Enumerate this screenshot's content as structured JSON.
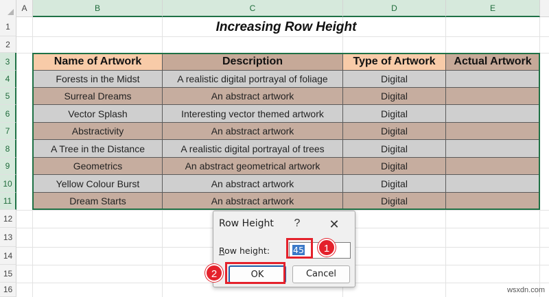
{
  "columns": [
    "A",
    "B",
    "C",
    "D",
    "E"
  ],
  "rows": [
    "1",
    "2",
    "3",
    "4",
    "5",
    "6",
    "7",
    "8",
    "9",
    "10",
    "11",
    "12",
    "13",
    "14",
    "15",
    "16"
  ],
  "sheet_title": "Increasing Row Height",
  "table": {
    "headers": [
      "Name of Artwork",
      "Description",
      "Type of Artwork",
      "Actual Artwork"
    ],
    "rows": [
      [
        "Forests in the Midst",
        "A realistic digital portrayal of  foliage",
        "Digital",
        ""
      ],
      [
        "Surreal Dreams",
        "An abstract artwork",
        "Digital",
        ""
      ],
      [
        "Vector Splash",
        "Interesting vector themed artwork",
        "Digital",
        ""
      ],
      [
        "Abstractivity",
        "An abstract artwork",
        "Digital",
        ""
      ],
      [
        "A Tree in the Distance",
        "A realistic digital portrayal of trees",
        "Digital",
        ""
      ],
      [
        "Geometrics",
        "An abstract geometrical artwork",
        "Digital",
        ""
      ],
      [
        "Yellow Colour Burst",
        "An abstract artwork",
        "Digital",
        ""
      ],
      [
        "Dream Starts",
        "An abstract artwork",
        "Digital",
        ""
      ]
    ]
  },
  "dialog": {
    "title": "Row Height",
    "help": "?",
    "close": "✕",
    "label_first": "R",
    "label_rest": "ow height:",
    "value": "45",
    "ok_label": "OK",
    "cancel_label": "Cancel"
  },
  "badges": [
    "1",
    "2"
  ],
  "watermark": "wsxdn.com",
  "colors": {
    "header_peach": "#f8cba8",
    "row_gray": "#cfcfcf",
    "row_brown": "#c6ad9f",
    "selection_green": "#1e7145",
    "annotation_red": "#e4212b"
  }
}
